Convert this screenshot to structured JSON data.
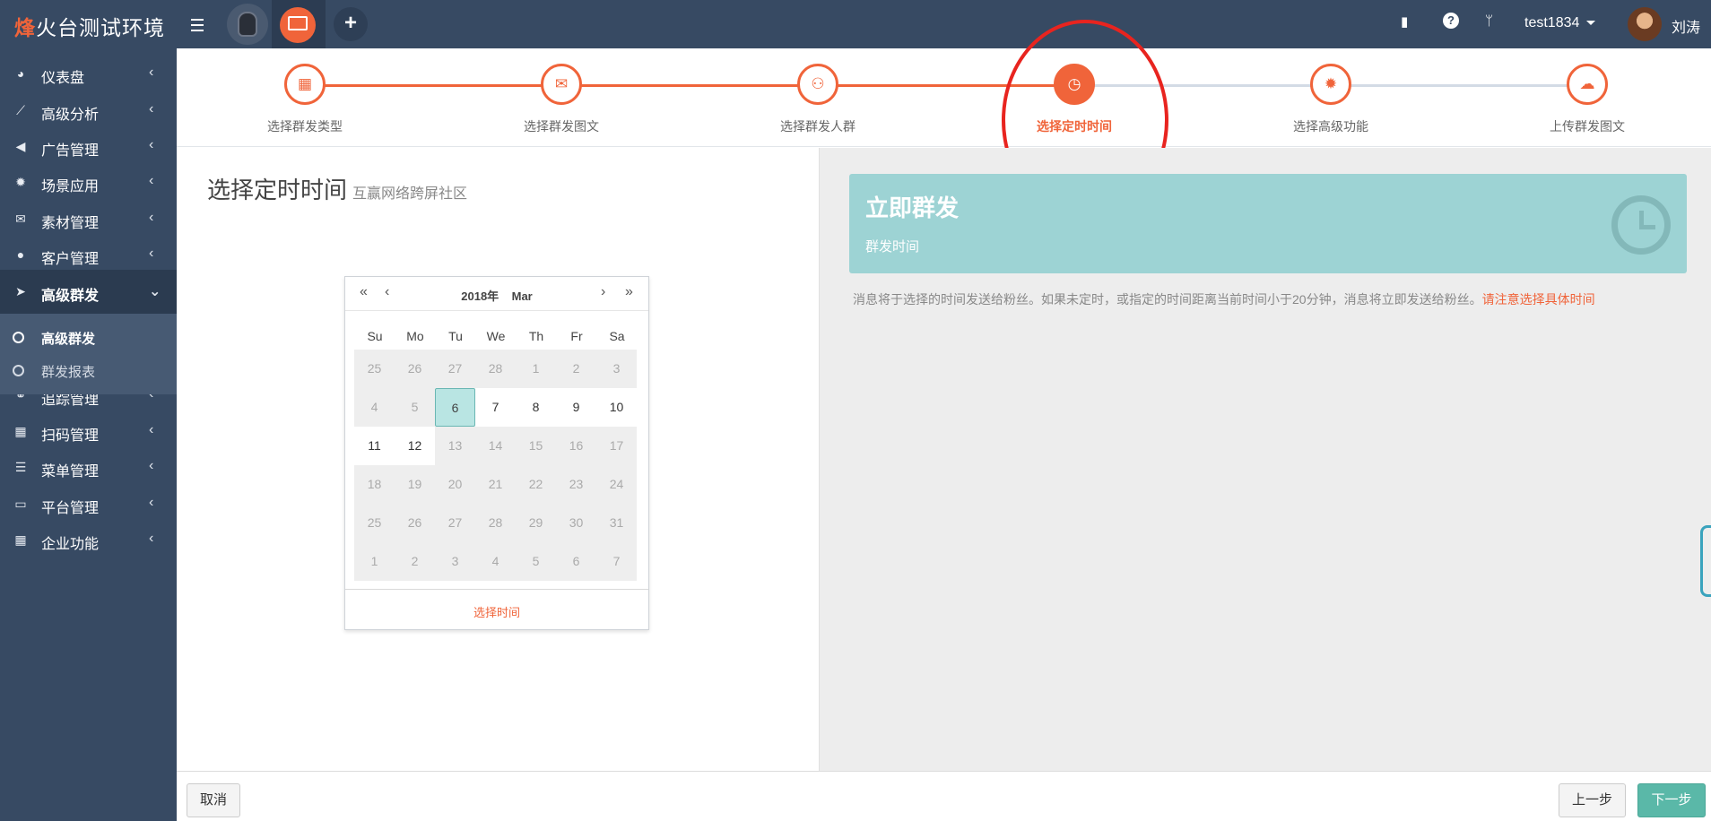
{
  "app": {
    "brand_first": "烽",
    "brand_rest": "火台测试环境",
    "username": "test1834",
    "real_name": "刘涛"
  },
  "topbar_icons": [
    "menu-icon",
    "mask-app-icon",
    "screen-app-icon",
    "plus-icon",
    "book-icon",
    "help-icon",
    "branch-icon",
    "caret-down-icon"
  ],
  "sidebar": {
    "items": [
      {
        "label": "仪表盘",
        "icon": "dashboard-icon",
        "glyph": "◕",
        "expanded": false
      },
      {
        "label": "高级分析",
        "icon": "line-chart-icon",
        "glyph": "⟋",
        "expanded": false
      },
      {
        "label": "广告管理",
        "icon": "bullhorn-icon",
        "glyph": "◀",
        "expanded": false
      },
      {
        "label": "场景应用",
        "icon": "gear-icon",
        "glyph": "✹",
        "expanded": false
      },
      {
        "label": "素材管理",
        "icon": "envelope-icon",
        "glyph": "✉",
        "expanded": false
      },
      {
        "label": "客户管理",
        "icon": "user-icon",
        "glyph": "●",
        "expanded": false
      },
      {
        "label": "高级群发",
        "icon": "paper-plane-icon",
        "glyph": "➤",
        "expanded": true
      },
      {
        "label": "追踪管理",
        "icon": "link-icon",
        "glyph": "⚭",
        "expanded": false
      },
      {
        "label": "扫码管理",
        "icon": "qrcode-icon",
        "glyph": "▦",
        "expanded": false
      },
      {
        "label": "菜单管理",
        "icon": "list-icon",
        "glyph": "☰",
        "expanded": false
      },
      {
        "label": "平台管理",
        "icon": "desktop-icon",
        "glyph": "▭",
        "expanded": false
      },
      {
        "label": "企业功能",
        "icon": "th-large-icon",
        "glyph": "▦",
        "expanded": false
      }
    ],
    "sub_items": [
      {
        "label": "高级群发",
        "active": true
      },
      {
        "label": "群发报表",
        "active": false
      }
    ]
  },
  "wizard": {
    "steps": [
      {
        "label": "选择群发类型",
        "icon": "th-large-icon",
        "glyph": "▦",
        "state": "done"
      },
      {
        "label": "选择群发图文",
        "icon": "envelope-icon",
        "glyph": "✉",
        "state": "done"
      },
      {
        "label": "选择群发人群",
        "icon": "users-icon",
        "glyph": "⚇",
        "state": "done"
      },
      {
        "label": "选择定时时间",
        "icon": "clock-icon",
        "glyph": "◷",
        "state": "current"
      },
      {
        "label": "选择高级功能",
        "icon": "gear-icon",
        "glyph": "✹",
        "state": "todo"
      },
      {
        "label": "上传群发图文",
        "icon": "cloud-upload-icon",
        "glyph": "☁",
        "state": "todo"
      }
    ],
    "done_color": "#f0643a",
    "todo_line_color": "#d3dbe5"
  },
  "main": {
    "title": "选择定时时间",
    "subtitle": "互赢网络跨屏社区"
  },
  "datepicker": {
    "prev_year": "«",
    "prev_month": "‹",
    "next_month": "›",
    "next_year": "»",
    "year": "2018年",
    "month": "Mar",
    "weekdays": [
      "Su",
      "Mo",
      "Tu",
      "We",
      "Th",
      "Fr",
      "Sa"
    ],
    "weeks": [
      [
        {
          "d": "25",
          "s": "dis"
        },
        {
          "d": "26",
          "s": "dis"
        },
        {
          "d": "27",
          "s": "dis"
        },
        {
          "d": "28",
          "s": "dis"
        },
        {
          "d": "1",
          "s": "dis"
        },
        {
          "d": "2",
          "s": "dis"
        },
        {
          "d": "3",
          "s": "dis"
        }
      ],
      [
        {
          "d": "4",
          "s": "dis"
        },
        {
          "d": "5",
          "s": "dis"
        },
        {
          "d": "6",
          "s": "sel"
        },
        {
          "d": "7",
          "s": "en"
        },
        {
          "d": "8",
          "s": "en"
        },
        {
          "d": "9",
          "s": "en"
        },
        {
          "d": "10",
          "s": "en"
        }
      ],
      [
        {
          "d": "11",
          "s": "en"
        },
        {
          "d": "12",
          "s": "en"
        },
        {
          "d": "13",
          "s": "dis"
        },
        {
          "d": "14",
          "s": "dis"
        },
        {
          "d": "15",
          "s": "dis"
        },
        {
          "d": "16",
          "s": "dis"
        },
        {
          "d": "17",
          "s": "dis"
        }
      ],
      [
        {
          "d": "18",
          "s": "dis"
        },
        {
          "d": "19",
          "s": "dis"
        },
        {
          "d": "20",
          "s": "dis"
        },
        {
          "d": "21",
          "s": "dis"
        },
        {
          "d": "22",
          "s": "dis"
        },
        {
          "d": "23",
          "s": "dis"
        },
        {
          "d": "24",
          "s": "dis"
        }
      ],
      [
        {
          "d": "25",
          "s": "dis"
        },
        {
          "d": "26",
          "s": "dis"
        },
        {
          "d": "27",
          "s": "dis"
        },
        {
          "d": "28",
          "s": "dis"
        },
        {
          "d": "29",
          "s": "dis"
        },
        {
          "d": "30",
          "s": "dis"
        },
        {
          "d": "31",
          "s": "dis"
        }
      ],
      [
        {
          "d": "1",
          "s": "dis"
        },
        {
          "d": "2",
          "s": "dis"
        },
        {
          "d": "3",
          "s": "dis"
        },
        {
          "d": "4",
          "s": "dis"
        },
        {
          "d": "5",
          "s": "dis"
        },
        {
          "d": "6",
          "s": "dis"
        },
        {
          "d": "7",
          "s": "dis"
        }
      ]
    ],
    "footer": "选择时间"
  },
  "info": {
    "title": "立即群发",
    "subtitle": "群发时间",
    "icon": "clock-icon",
    "notice": "消息将于选择的时间发送给粉丝。如果未定时，或指定的时间距离当前时间小于20分钟，消息将立即发送给粉丝。",
    "notice_warn": "请注意选择具体时间"
  },
  "footer": {
    "cancel": "取消",
    "prev": "上一步",
    "next": "下一步"
  },
  "colors": {
    "topbar": "#374a63",
    "accent": "#f0643a",
    "info_box": "#9dd3d4",
    "next_button": "#5ab8a8",
    "annotation": "#e8241f"
  }
}
